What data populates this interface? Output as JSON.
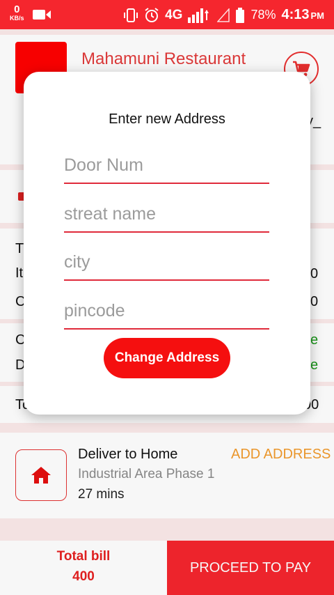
{
  "status_bar": {
    "net_speed": "0",
    "net_speed_unit": "KB/s",
    "network": "4G",
    "battery": "78%",
    "time": "4:13",
    "ampm": "PM"
  },
  "restaurant": {
    "name": "Mahamuni Restaurant"
  },
  "background_fragments": {
    "t1": "T",
    "it": "It",
    "c1": "C",
    "c2": "C",
    "d": "D",
    "to": "To",
    "v1": "0",
    "v2": "0",
    "g1": "e",
    "g2": "e",
    "v3": "00",
    "y": "y_"
  },
  "modal": {
    "title": "Enter new Address",
    "door_placeholder": "Door Num",
    "street_placeholder": "streat name",
    "city_placeholder": "city",
    "pincode_placeholder": "pincode",
    "button_label": "Change Address"
  },
  "delivery": {
    "title": "Deliver to Home",
    "area": "Industrial Area Phase 1",
    "time": "27 mins",
    "add_address_label": "ADD ADDRESS"
  },
  "footer": {
    "total_label": "Total bill",
    "total_value": "400",
    "pay_label": "PROCEED TO PAY"
  },
  "colors": {
    "accent": "#f5262e",
    "add_address": "#f29b2d",
    "free_green": "#1a9a1a"
  }
}
